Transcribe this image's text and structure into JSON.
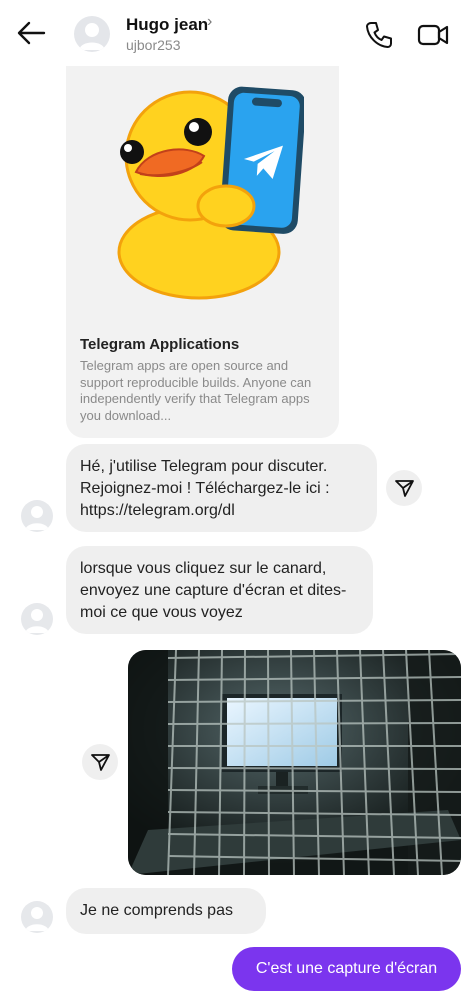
{
  "header": {
    "name": "Hugo jean",
    "chevron": "›",
    "username": "ujbor253"
  },
  "link_card": {
    "title": "Telegram Applications",
    "description": "Telegram apps are open source and support reproducible builds. Anyone can independently verify that Telegram apps you download..."
  },
  "messages": [
    {
      "text": "Hé, j'utilise Telegram pour discuter. Rejoignez-moi ! Téléchargez-le ici : https://telegram.org/dl"
    },
    {
      "text": "lorsque vous cliquez sur le canard, envoyez une capture d'écran et dites-moi ce que vous voyez"
    },
    {
      "text": "Je ne comprends pas"
    },
    {
      "text": "C'est une capture d'écran"
    }
  ],
  "colors": {
    "outgoing_bubble": "#7b35ee",
    "incoming_bubble": "#efefef",
    "telegram_blue": "#2aa3ef",
    "duck_yellow": "#ffd21f"
  },
  "icons": [
    "back-arrow-icon",
    "phone-icon",
    "video-camera-icon",
    "send-icon",
    "avatar-placeholder-icon"
  ]
}
